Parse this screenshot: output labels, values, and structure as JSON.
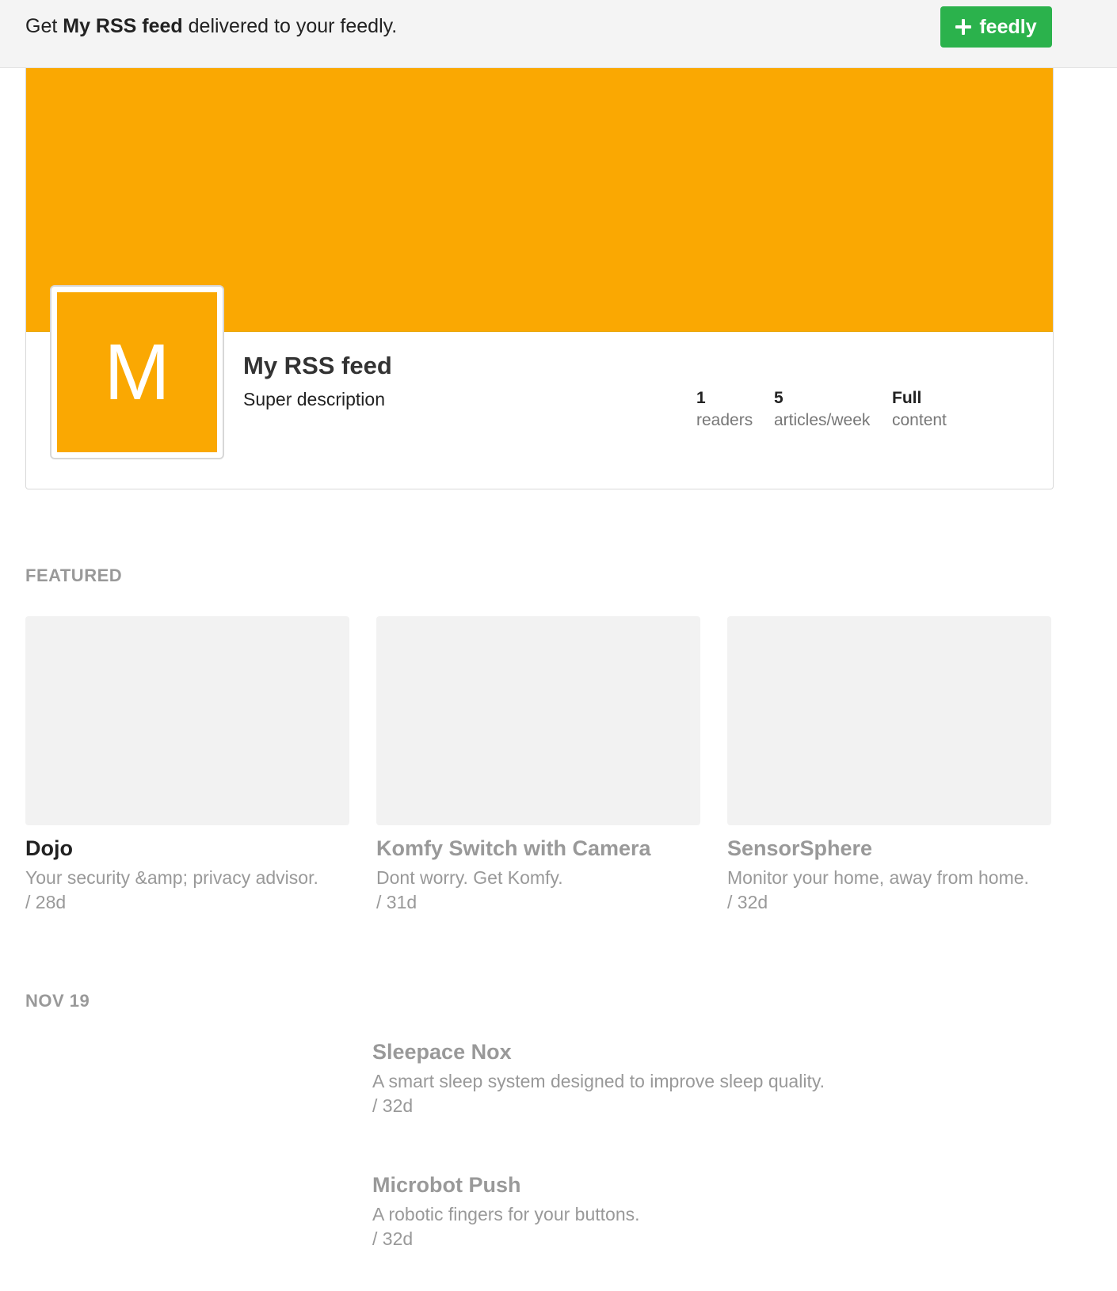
{
  "banner": {
    "prefix": "Get ",
    "feed_name": "My RSS feed",
    "suffix": " delivered to your feedly.",
    "follow_label": "feedly",
    "follow_color": "#2bb24c"
  },
  "feed": {
    "title": "My RSS feed",
    "description": "Super description",
    "avatar_letter": "M",
    "accent_color": "#faa802",
    "stats": [
      {
        "value": "1",
        "label": "readers"
      },
      {
        "value": "5",
        "label": "articles/week"
      },
      {
        "value": "Full",
        "label": "content"
      }
    ]
  },
  "featured": {
    "heading": "FEATURED",
    "items": [
      {
        "title": "Dojo",
        "summary": "Your security &amp; privacy advisor.",
        "age": "/ 28d",
        "title_color": "#222222"
      },
      {
        "title": "Komfy Switch with Camera",
        "summary": "Dont worry. Get Komfy.",
        "age": "/ 31d",
        "title_color": "#999999"
      },
      {
        "title": "SensorSphere",
        "summary": "Monitor your home, away from home.",
        "age": "/ 32d",
        "title_color": "#999999"
      }
    ]
  },
  "day_section": {
    "heading": "NOV 19",
    "items": [
      {
        "title": "Sleepace Nox",
        "summary": "A smart sleep system designed to improve sleep quality.",
        "age": "/ 32d"
      },
      {
        "title": "Microbot Push",
        "summary": "A robotic fingers for your buttons.",
        "age": "/ 32d"
      }
    ]
  }
}
